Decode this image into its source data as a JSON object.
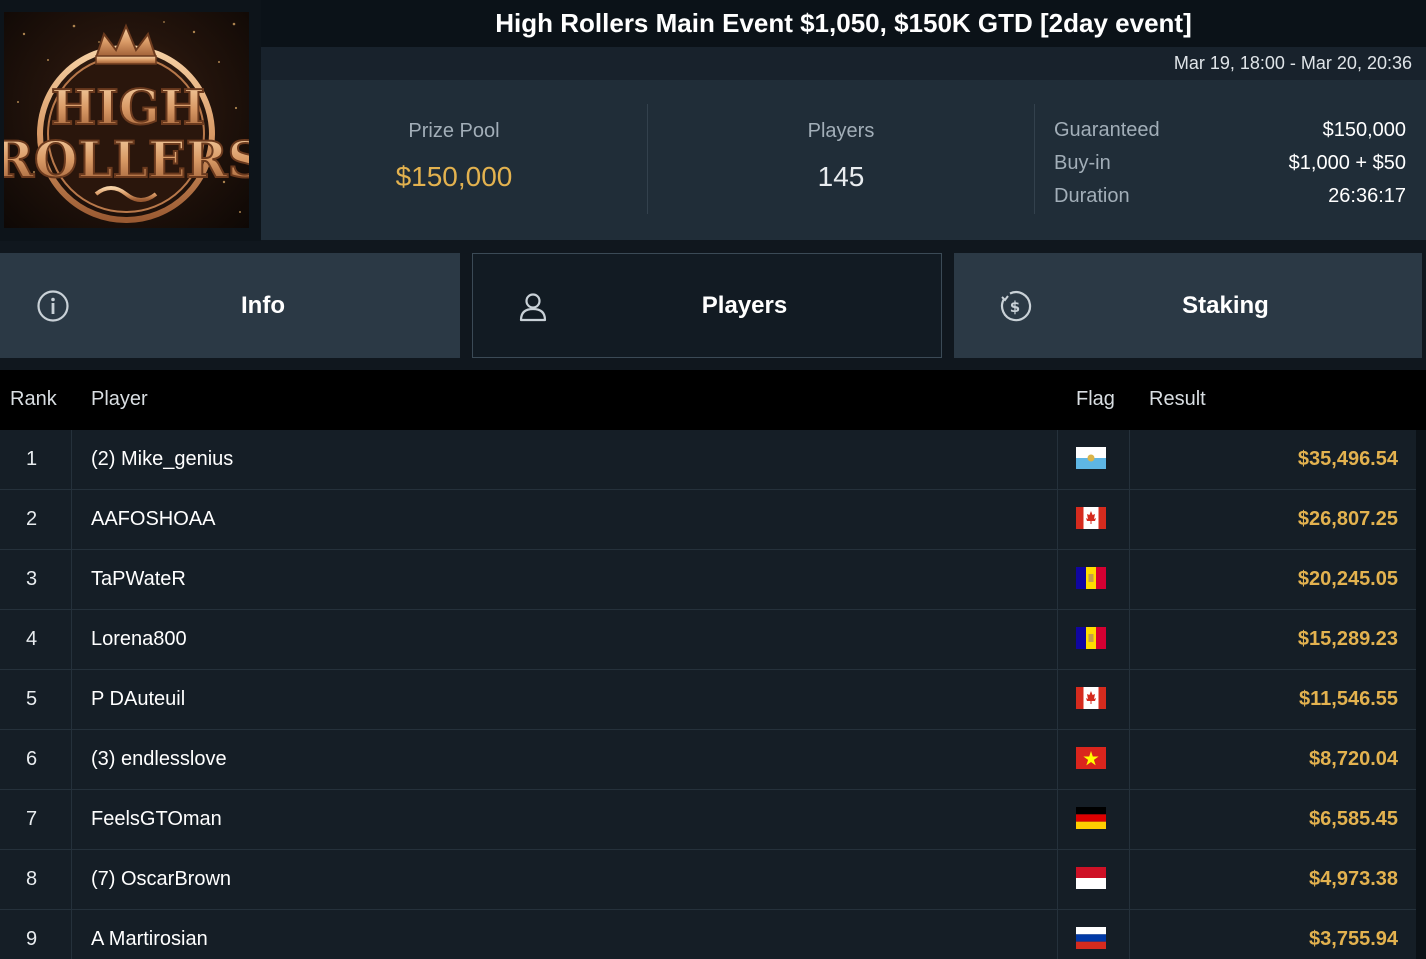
{
  "event": {
    "title": "High Rollers Main Event $1,050, $150K GTD [2day event]",
    "dates": "Mar 19, 18:00 - Mar 20, 20:36",
    "logo_text": [
      "HIGH",
      "ROLLERS"
    ]
  },
  "stats": {
    "prize_pool_label": "Prize Pool",
    "prize_pool_value": "$150,000",
    "players_label": "Players",
    "players_value": "145",
    "details": [
      {
        "key": "Guaranteed",
        "value": "$150,000"
      },
      {
        "key": "Buy-in",
        "value": "$1,000 + $50"
      },
      {
        "key": "Duration",
        "value": "26:36:17"
      }
    ]
  },
  "tabs": [
    {
      "label": "Info",
      "icon": "info-icon",
      "active": false
    },
    {
      "label": "Players",
      "icon": "user-icon",
      "active": true
    },
    {
      "label": "Staking",
      "icon": "dollar-coin-icon",
      "active": false
    }
  ],
  "table": {
    "headers": {
      "rank": "Rank",
      "player": "Player",
      "flag": "Flag",
      "result": "Result"
    },
    "rows": [
      {
        "rank": "1",
        "player": "(2) Mike_genius",
        "flag": "san-marino",
        "result": "$35,496.54"
      },
      {
        "rank": "2",
        "player": "AAFOSHOAA",
        "flag": "canada",
        "result": "$26,807.25"
      },
      {
        "rank": "3",
        "player": "TaPWateR",
        "flag": "andorra",
        "result": "$20,245.05"
      },
      {
        "rank": "4",
        "player": "Lorena800",
        "flag": "andorra",
        "result": "$15,289.23"
      },
      {
        "rank": "5",
        "player": "P DAuteuil",
        "flag": "canada",
        "result": "$11,546.55"
      },
      {
        "rank": "6",
        "player": "(3) endlesslove",
        "flag": "vietnam",
        "result": "$8,720.04"
      },
      {
        "rank": "7",
        "player": "FeelsGTOman",
        "flag": "germany",
        "result": "$6,585.45"
      },
      {
        "rank": "8",
        "player": "(7) OscarBrown",
        "flag": "monaco",
        "result": "$4,973.38"
      },
      {
        "rank": "9",
        "player": "A Martirosian",
        "flag": "russia",
        "result": "$3,755.94"
      }
    ]
  },
  "colors": {
    "accent_gold": "#e3b24f",
    "background": "#10171e",
    "panel": "#202d38"
  }
}
